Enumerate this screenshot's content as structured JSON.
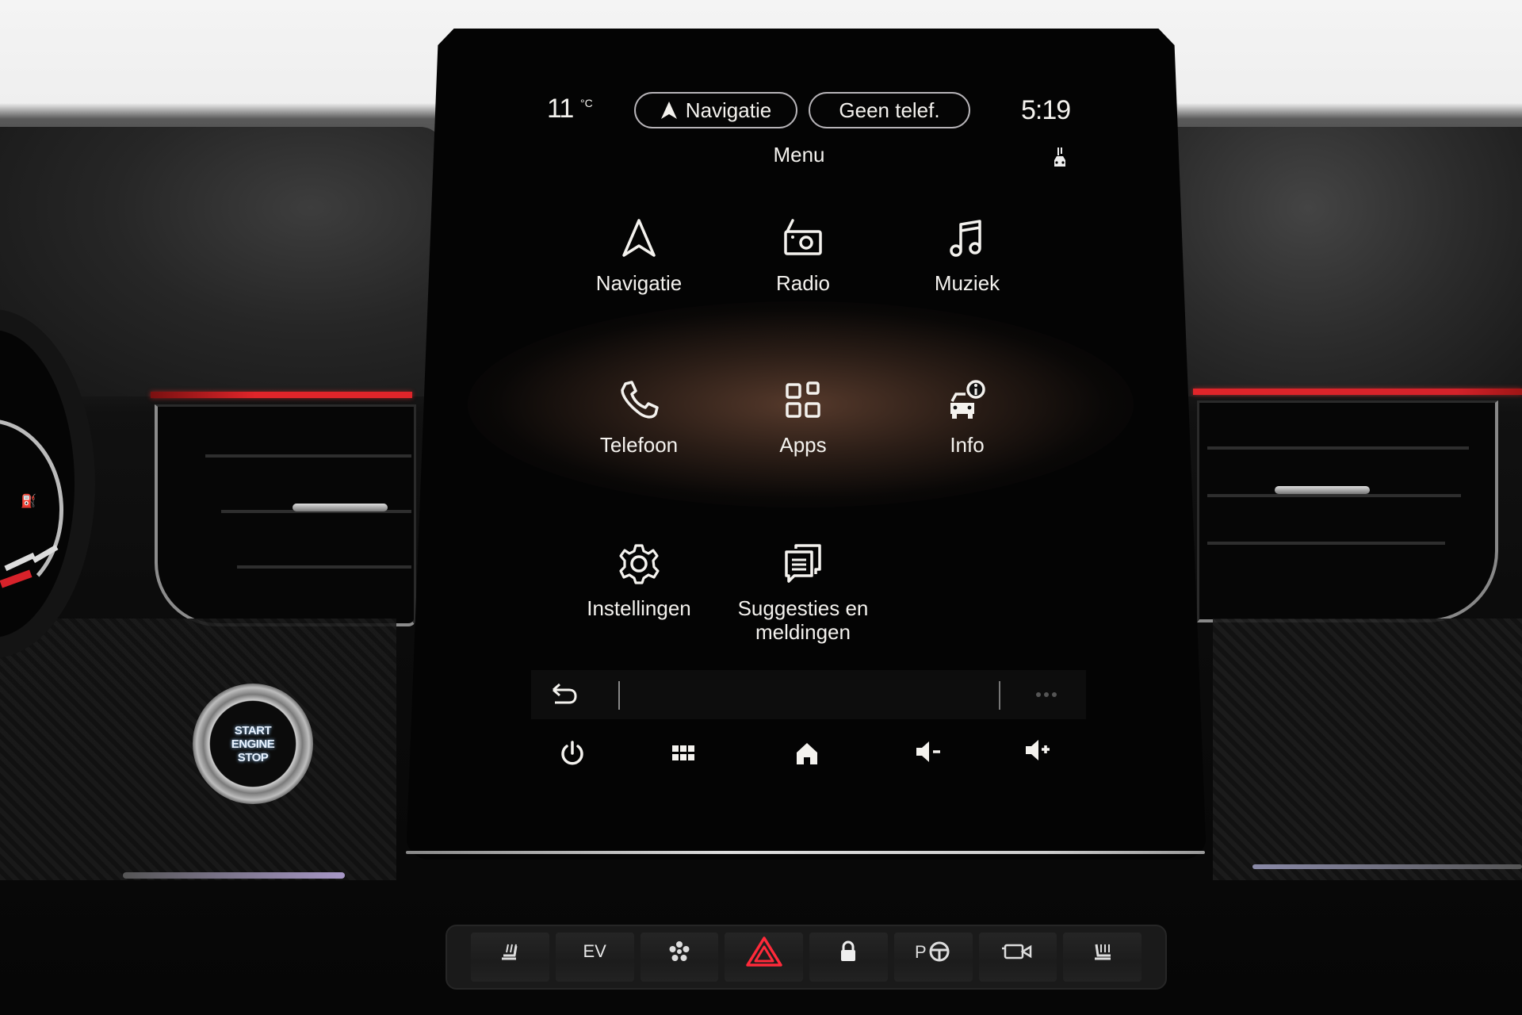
{
  "status_bar": {
    "temperature": "11",
    "temperature_unit": "°C",
    "nav_pill_label": "Navigatie",
    "phone_pill_label": "Geen telef.",
    "clock": "5:19",
    "page_title": "Menu",
    "status_icon": "car-status-icon"
  },
  "menu_tiles": [
    {
      "label": "Navigatie",
      "icon": "navigation-arrow-icon"
    },
    {
      "label": "Radio",
      "icon": "radio-icon"
    },
    {
      "label": "Muziek",
      "icon": "music-note-icon"
    },
    {
      "label": "Telefoon",
      "icon": "phone-icon"
    },
    {
      "label": "Apps",
      "icon": "apps-grid-icon"
    },
    {
      "label": "Info",
      "icon": "car-info-icon"
    },
    {
      "label": "Instellingen",
      "icon": "gear-icon"
    },
    {
      "label": "Suggesties en meldingen",
      "icon": "notifications-icon"
    }
  ],
  "context_bar": {
    "back_icon": "back-arrow-icon",
    "more_icon": "more-dots-icon"
  },
  "bottom_nav": [
    {
      "name": "power",
      "icon": "power-icon"
    },
    {
      "name": "apps",
      "icon": "grid-icon"
    },
    {
      "name": "home",
      "icon": "home-icon"
    },
    {
      "name": "volume-down",
      "icon": "volume-down-icon"
    },
    {
      "name": "volume-up",
      "icon": "volume-up-icon"
    }
  ],
  "start_button": {
    "line1": "START",
    "line2": "ENGINE",
    "line3": "STOP"
  },
  "hardware_buttons": [
    {
      "label": "",
      "icon": "heated-seat-left-icon"
    },
    {
      "label": "EV",
      "icon": ""
    },
    {
      "label": "",
      "icon": "fan-icon"
    },
    {
      "label": "",
      "icon": "hazard-icon"
    },
    {
      "label": "",
      "icon": "lock-icon"
    },
    {
      "label": "",
      "icon": "park-assist-icon"
    },
    {
      "label": "",
      "icon": "camera-icon"
    },
    {
      "label": "",
      "icon": "heated-seat-right-icon"
    }
  ],
  "colors": {
    "screen_bg": "#050505",
    "text": "#f4f2ee",
    "pill_border": "#b7b4b8",
    "ambient_red": "#e0252a",
    "hazard_red": "#ff2a3a"
  }
}
